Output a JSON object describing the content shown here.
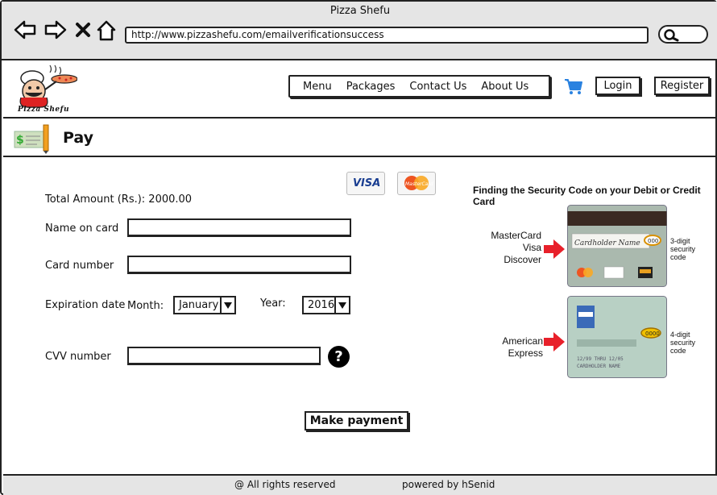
{
  "window": {
    "title": "Pizza Shefu"
  },
  "address_bar": {
    "url": "http://www.pizzashefu.com/emailverificationsuccess"
  },
  "header": {
    "logo_text": "Pizza Shefu",
    "nav": [
      "Menu",
      "Packages",
      "Contact Us",
      "About Us"
    ],
    "login_label": "Login",
    "register_label": "Register"
  },
  "page": {
    "title": "Pay"
  },
  "form": {
    "total_amount": "Total Amount (Rs.): 2000.00",
    "name_label": "Name on card",
    "card_number_label": "Card number",
    "expiration_label": "Expiration date",
    "month_label": "Month:",
    "month_value": "January",
    "year_label": "Year:",
    "year_value": "2016",
    "cvv_label": "CVV number",
    "help_symbol": "?",
    "submit_label": "Make payment"
  },
  "card_logos": {
    "visa": "VISA",
    "mastercard": "MasterCard"
  },
  "security_info": {
    "title": "Finding the Security Code on your Debit or Credit Card",
    "group1_brands": [
      "MasterCard",
      "Visa",
      "Discover"
    ],
    "group1_code": [
      "3-digit",
      "security",
      "code"
    ],
    "group2_brand": "American Express",
    "group2_code": [
      "4-digit",
      "security",
      "code"
    ],
    "card_back_text": "Cardholder Name",
    "card_back_code": "000",
    "amex_code": "0000",
    "amex_line1": "12/99 THRU 12/05",
    "amex_line2": "CARDHOLDER NAME"
  },
  "footer": {
    "copyright": "@ All rights reserved",
    "powered_by": "powered by hSenid"
  },
  "colors": {
    "chrome": "#e5e5e5",
    "cart": "#2a82e0",
    "arrow": "#e8202a",
    "visa": "#1a3e91"
  }
}
